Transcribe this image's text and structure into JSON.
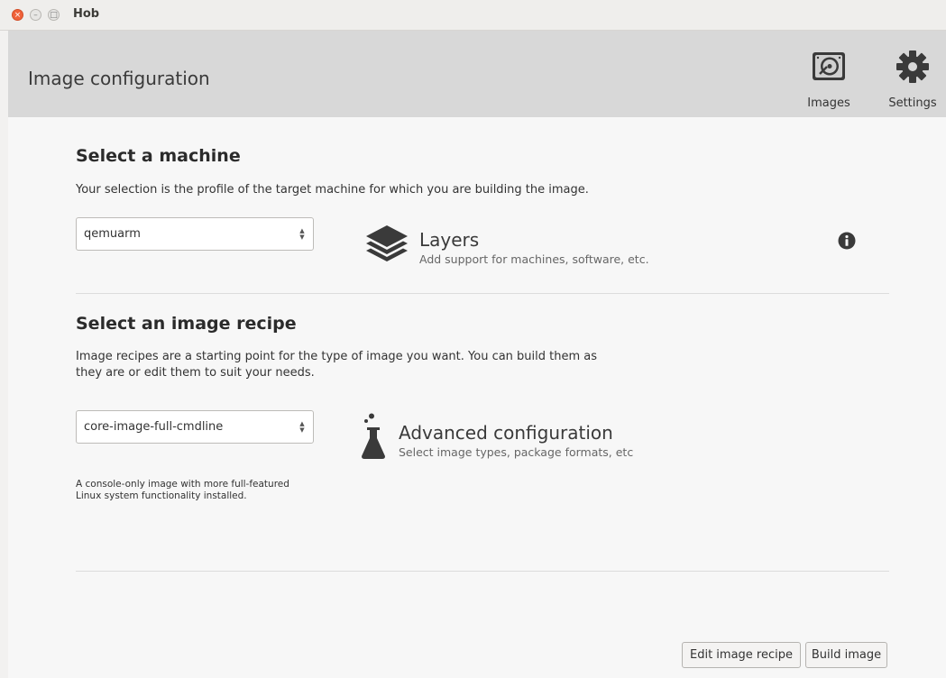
{
  "window": {
    "title": "Hob"
  },
  "header": {
    "title": "Image configuration",
    "images_label": "Images",
    "settings_label": "Settings"
  },
  "machine": {
    "heading": "Select a machine",
    "description": "Your selection is the profile of the target machine for which you are building the image.",
    "selected": "qemuarm"
  },
  "layers": {
    "title": "Layers",
    "subtitle": "Add support for machines, software, etc."
  },
  "recipe": {
    "heading": "Select an image recipe",
    "description_line1": "Image recipes are a starting point for the type of image you want. You can build them as",
    "description_line2": "they are or edit them to suit your needs.",
    "selected": "core-image-full-cmdline",
    "note_line1": "A console-only image with more full-featured",
    "note_line2": "Linux system functionality installed."
  },
  "advanced": {
    "title": "Advanced configuration",
    "subtitle": "Select image types, package formats, etc"
  },
  "buttons": {
    "edit_recipe": "Edit image recipe",
    "build_image": "Build image"
  },
  "icons": {
    "close": "close-icon",
    "minimize": "minimize-icon",
    "maximize": "maximize-icon",
    "images": "hard-disk-icon",
    "settings": "gear-icon",
    "layers": "layers-icon",
    "info": "info-icon",
    "advanced": "flask-icon"
  },
  "colors": {
    "header_bg": "#d8d8d8",
    "close_button": "#f0623a",
    "icon_dark": "#3a3a3a"
  }
}
